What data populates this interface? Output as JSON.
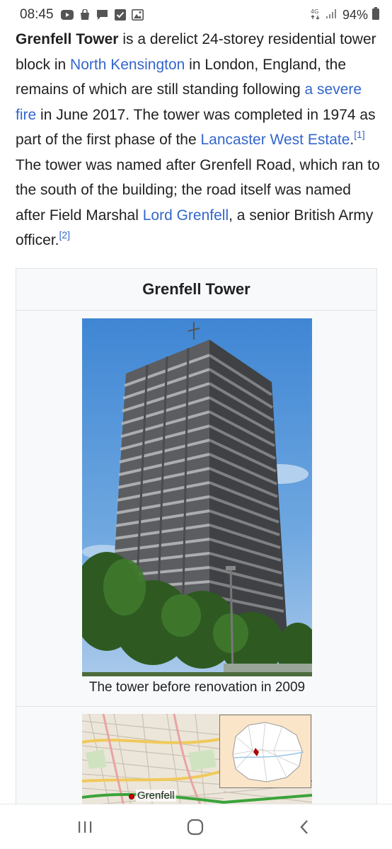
{
  "status_bar": {
    "time": "08:45",
    "battery": "94%",
    "icons": [
      "youtube-icon",
      "bag-icon",
      "message-icon",
      "checkbox-icon",
      "gallery-icon",
      "wifi-calling-icon",
      "signal-icon",
      "battery-icon"
    ]
  },
  "article": {
    "s1_bold": "Grenfell Tower",
    "s1_text": " is a derelict 24-storey residential tower block in ",
    "link_north_kensington": "North Kensington",
    "s2_text": " in London, England, the remains of which are still standing following ",
    "link_severe_fire": "a severe fire",
    "s3_text": " in June 2017. The tower was completed in 1974 as part of the first phase of the ",
    "link_lancaster": "Lancaster West Estate",
    "s3b_text": ".",
    "ref1": "[1]",
    "s4_text": " The tower was named after Grenfell Road, which ran to the south of the building; the road itself was named after Field Marshal ",
    "link_lord_grenfell": "Lord Grenfell",
    "s5_text": ", a senior British Army officer.",
    "ref2": "[2]"
  },
  "infobox": {
    "title": "Grenfell Tower",
    "photo_caption": "The tower before renovation in 2009",
    "map_label": "Grenfell"
  },
  "colors": {
    "link": "#3366cc",
    "text": "#202122",
    "infobox_bg": "#f8f9fa",
    "sky": "#5a9ad8",
    "tower": "#4a4c4f"
  }
}
